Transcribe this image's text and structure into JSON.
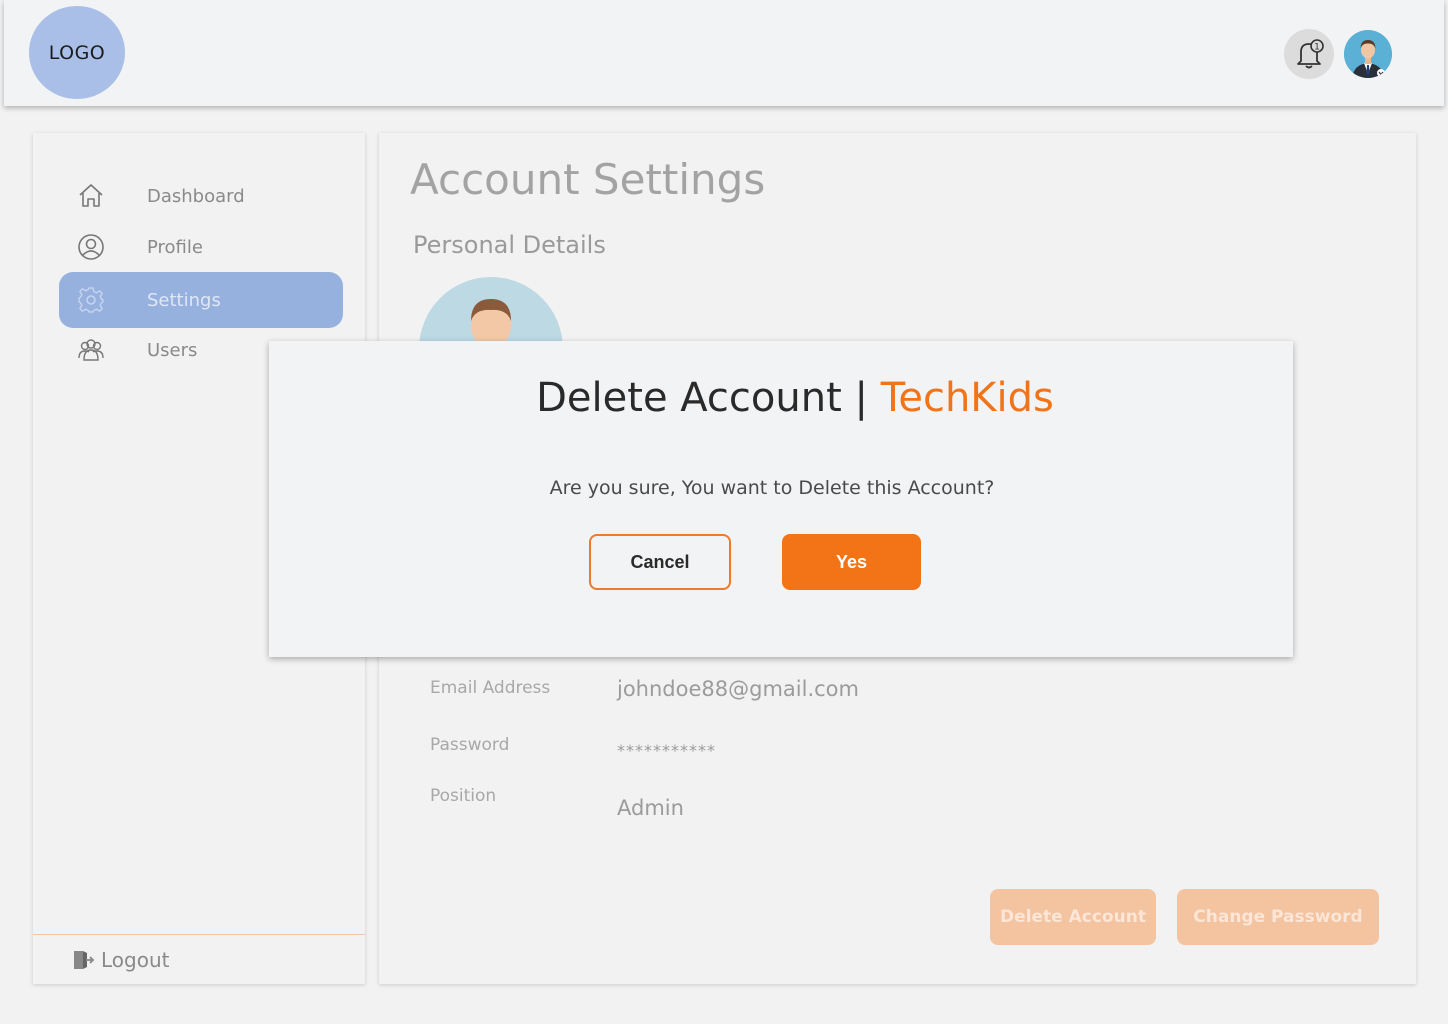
{
  "header": {
    "logo_text": "LOGO",
    "notification_icon": "bell-icon",
    "notification_badge": "1",
    "avatar_icon": "user-avatar"
  },
  "sidebar": {
    "items": [
      {
        "label": "Dashboard",
        "icon": "home-icon",
        "active": false
      },
      {
        "label": "Profile",
        "icon": "user-circle-icon",
        "active": false
      },
      {
        "label": "Settings",
        "icon": "gear-icon",
        "active": true
      },
      {
        "label": "Users",
        "icon": "users-icon",
        "active": false
      }
    ],
    "logout_label": "Logout",
    "logout_icon": "logout-icon"
  },
  "main": {
    "title": "Account Settings",
    "section_title": "Personal Details",
    "fields": [
      {
        "label": "Email Address",
        "value": "johndoe88@gmail.com"
      },
      {
        "label": "Password",
        "value": "***********"
      },
      {
        "label": "Position",
        "value": "Admin"
      }
    ],
    "delete_account_label": "Delete Account",
    "change_password_label": "Change Password"
  },
  "modal": {
    "title": "Delete Account",
    "separator": "|",
    "brand": "TechKids",
    "message": "Are you sure, You want to Delete this Account?",
    "cancel_label": "Cancel",
    "yes_label": "Yes"
  },
  "colors": {
    "accent": "#f37417",
    "sidebar_active": "#97b1df",
    "logo_bg": "#a9bfe7"
  }
}
